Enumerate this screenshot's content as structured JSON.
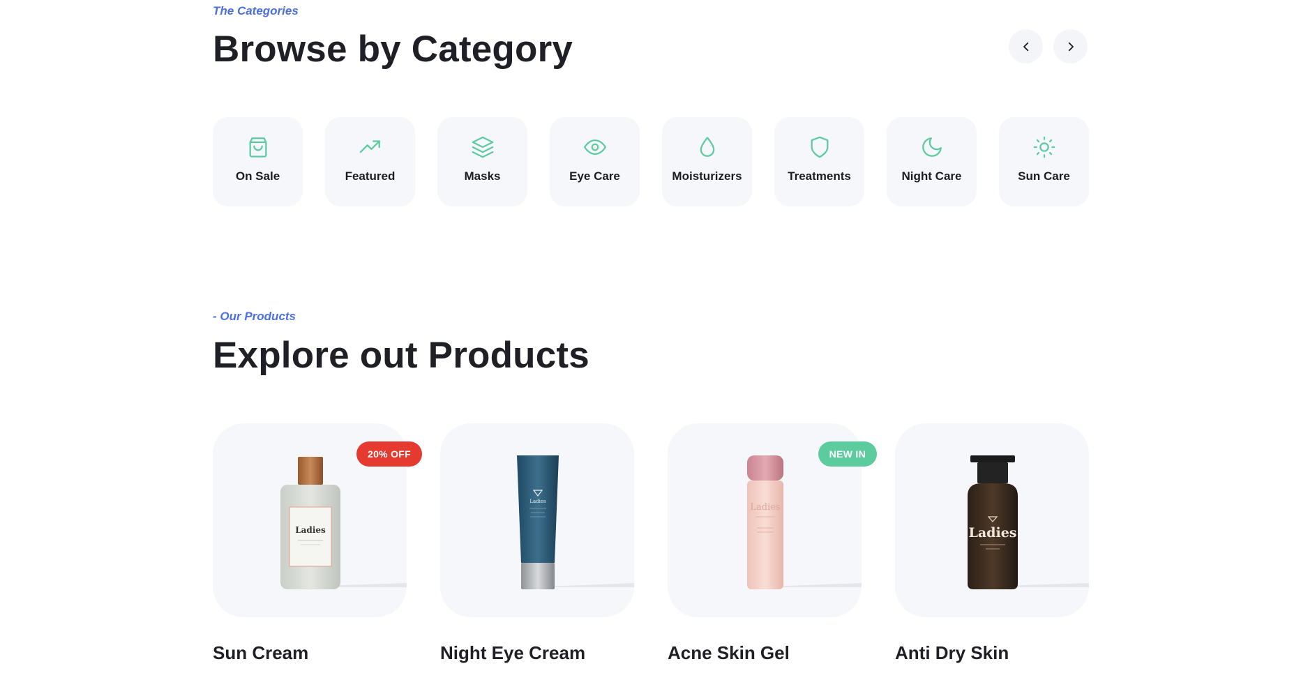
{
  "categories_section": {
    "eyebrow": "The Categories",
    "title": "Browse by Category",
    "prev_icon": "chevron-left-icon",
    "next_icon": "chevron-right-icon",
    "items": [
      {
        "label": "On Sale",
        "icon": "shopping-bag-icon"
      },
      {
        "label": "Featured",
        "icon": "trending-up-icon"
      },
      {
        "label": "Masks",
        "icon": "layers-icon"
      },
      {
        "label": "Eye Care",
        "icon": "eye-icon"
      },
      {
        "label": "Moisturizers",
        "icon": "droplet-icon"
      },
      {
        "label": "Treatments",
        "icon": "shield-icon"
      },
      {
        "label": "Night Care",
        "icon": "moon-icon"
      },
      {
        "label": "Sun Care",
        "icon": "sun-icon"
      }
    ]
  },
  "products_section": {
    "eyebrow": "- Our Products",
    "title": "Explore out Products",
    "items": [
      {
        "name": "Sun Cream",
        "badge": "20% OFF",
        "brand": "Ladies"
      },
      {
        "name": "Night Eye Cream",
        "badge": "",
        "brand": "Ladies"
      },
      {
        "name": "Acne Skin Gel",
        "badge": "NEW IN",
        "brand": "Ladies"
      },
      {
        "name": "Anti Dry Skin",
        "badge": "",
        "brand": "Ladies"
      }
    ]
  },
  "colors": {
    "accent": "#4a6fe3",
    "icon": "#5ccb9d",
    "sale_badge": "#e53a2f",
    "new_badge": "#5ccb9d",
    "card_bg": "#f6f7fb"
  }
}
